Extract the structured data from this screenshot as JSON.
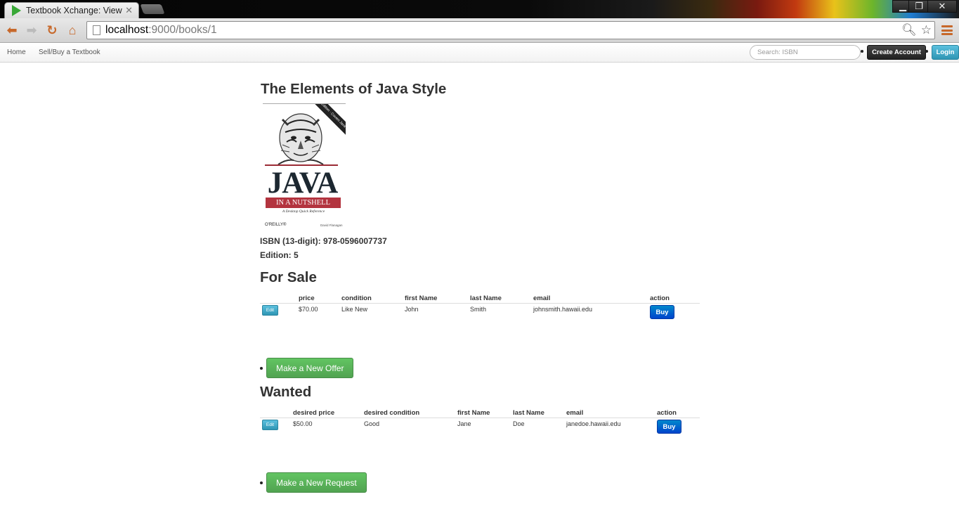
{
  "browser": {
    "tab_title": "Textbook Xchange: View a",
    "url_host": "localhost",
    "url_rest": ":9000/books/1"
  },
  "nav": {
    "home": "Home",
    "sell_buy": "Sell/Buy a Textbook",
    "search_placeholder": "Search: ISBN",
    "create_account": "Create Account",
    "login": "Login"
  },
  "book": {
    "title": "The Elements of Java Style",
    "isbn_line": "ISBN (13-digit): 978-0596007737",
    "edition_line": "Edition: 5",
    "cover": {
      "band": "5th Edition · Covers Java 5.0",
      "title": "JAVA",
      "subtitle": "IN A NUTSHELL",
      "tagline": "A Desktop Quick Reference",
      "publisher": "O'REILLY®",
      "author": "David Flanagan"
    }
  },
  "for_sale": {
    "heading": "For Sale",
    "columns": [
      "price",
      "condition",
      "first Name",
      "last Name",
      "email",
      "action"
    ],
    "rows": [
      {
        "edit": "Edit",
        "price": "$70.00",
        "condition": "Like New",
        "first": "John",
        "last": "Smith",
        "email": "johnsmith.hawaii.edu",
        "action": "Buy"
      }
    ],
    "new_button": "Make a New Offer"
  },
  "wanted": {
    "heading": "Wanted",
    "columns": [
      "desired price",
      "desired condition",
      "first Name",
      "last Name",
      "email",
      "action"
    ],
    "rows": [
      {
        "edit": "Edit",
        "price": "$50.00",
        "condition": "Good",
        "first": "Jane",
        "last": "Doe",
        "email": "janedoe.hawaii.edu",
        "action": "Buy"
      }
    ],
    "new_button": "Make a New Request"
  },
  "icons": [
    "play-icon",
    "close-icon",
    "back-icon",
    "forward-icon",
    "reload-icon",
    "home-icon",
    "page-icon",
    "zoom-icon",
    "star-icon",
    "menu-icon"
  ]
}
